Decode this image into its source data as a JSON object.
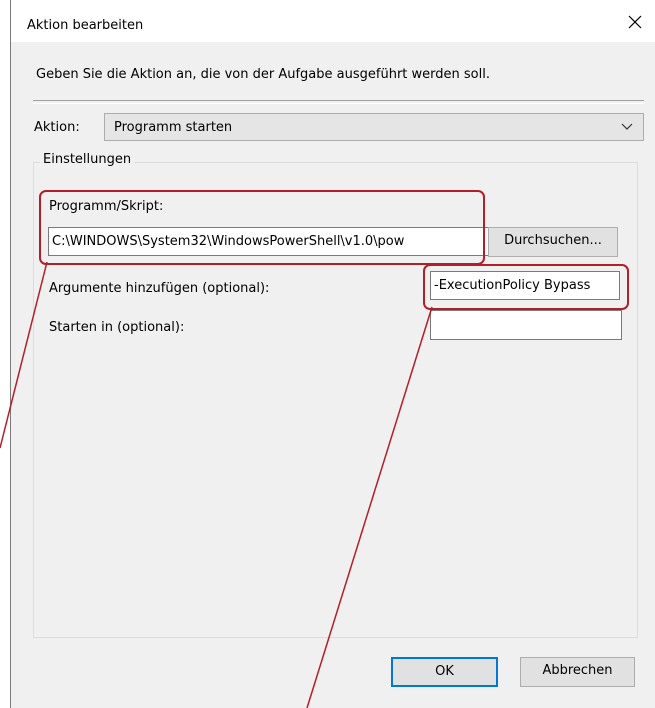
{
  "window": {
    "title": "Aktion bearbeiten",
    "close_icon": "close-icon"
  },
  "instruction": "Geben Sie die Aktion an, die von der Aufgabe ausgeführt werden soll.",
  "action": {
    "label": "Aktion:",
    "selected": "Programm starten"
  },
  "settings": {
    "legend": "Einstellungen",
    "program": {
      "label": "Programm/Skript:",
      "value": "C:\\WINDOWS\\System32\\WindowsPowerShell\\v1.0\\pow"
    },
    "browse_label": "Durchsuchen...",
    "arguments": {
      "label": "Argumente hinzufügen (optional):",
      "value": "-ExecutionPolicy Bypass"
    },
    "start_in": {
      "label": "Starten in (optional):",
      "value": ""
    }
  },
  "buttons": {
    "ok": "OK",
    "cancel": "Abbrechen"
  },
  "colors": {
    "highlight": "#b41e28",
    "accent": "#0078d7",
    "dialog_bg": "#f0f0f0"
  }
}
